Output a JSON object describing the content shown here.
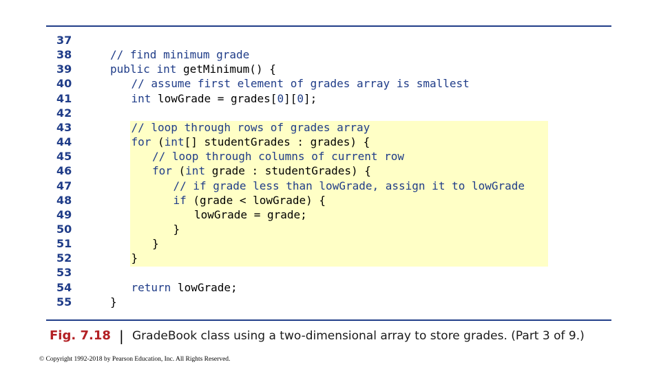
{
  "colors": {
    "rule": "#1f3c88",
    "highlight": "#ffffc6",
    "keyword": "#1f3c88",
    "figure_label": "#b32024"
  },
  "code": [
    {
      "line": "37",
      "indent": 0,
      "tokens": []
    },
    {
      "line": "38",
      "indent": 0,
      "tokens": [
        {
          "t": "// find minimum grade",
          "c": "cm"
        }
      ]
    },
    {
      "line": "39",
      "indent": 0,
      "tokens": [
        {
          "t": "public",
          "c": "kw"
        },
        {
          "t": " "
        },
        {
          "t": "int",
          "c": "kw"
        },
        {
          "t": " getMinimum() {"
        }
      ]
    },
    {
      "line": "40",
      "indent": 1,
      "tokens": [
        {
          "t": "// assume first element of grades array is smallest",
          "c": "cm"
        }
      ]
    },
    {
      "line": "41",
      "indent": 1,
      "tokens": [
        {
          "t": "int",
          "c": "kw"
        },
        {
          "t": " lowGrade = grades["
        },
        {
          "t": "0",
          "c": "num"
        },
        {
          "t": "]["
        },
        {
          "t": "0",
          "c": "num"
        },
        {
          "t": "];"
        }
      ]
    },
    {
      "line": "42",
      "indent": 0,
      "tokens": []
    },
    {
      "line": "43",
      "indent": 1,
      "tokens": [
        {
          "t": "// loop through rows of grades array",
          "c": "cm"
        }
      ]
    },
    {
      "line": "44",
      "indent": 1,
      "tokens": [
        {
          "t": "for",
          "c": "kw"
        },
        {
          "t": " ("
        },
        {
          "t": "int",
          "c": "kw"
        },
        {
          "t": "[] studentGrades : grades) {"
        }
      ]
    },
    {
      "line": "45",
      "indent": 2,
      "tokens": [
        {
          "t": "// loop through columns of current row",
          "c": "cm"
        }
      ]
    },
    {
      "line": "46",
      "indent": 2,
      "tokens": [
        {
          "t": "for",
          "c": "kw"
        },
        {
          "t": " ("
        },
        {
          "t": "int",
          "c": "kw"
        },
        {
          "t": " grade : studentGrades) {"
        }
      ]
    },
    {
      "line": "47",
      "indent": 3,
      "tokens": [
        {
          "t": "// if grade less than lowGrade, assign it to lowGrade",
          "c": "cm"
        }
      ]
    },
    {
      "line": "48",
      "indent": 3,
      "tokens": [
        {
          "t": "if",
          "c": "kw"
        },
        {
          "t": " (grade < lowGrade) {"
        }
      ]
    },
    {
      "line": "49",
      "indent": 4,
      "tokens": [
        {
          "t": "lowGrade = grade;"
        }
      ]
    },
    {
      "line": "50",
      "indent": 3,
      "tokens": [
        {
          "t": "}"
        }
      ]
    },
    {
      "line": "51",
      "indent": 2,
      "tokens": [
        {
          "t": "}"
        }
      ]
    },
    {
      "line": "52",
      "indent": 1,
      "tokens": [
        {
          "t": "}"
        }
      ]
    },
    {
      "line": "53",
      "indent": 0,
      "tokens": []
    },
    {
      "line": "54",
      "indent": 1,
      "tokens": [
        {
          "t": "return",
          "c": "kw"
        },
        {
          "t": " lowGrade;"
        }
      ]
    },
    {
      "line": "55",
      "indent": 0,
      "tokens": [
        {
          "t": "}"
        }
      ]
    }
  ],
  "caption": {
    "label": "Fig. 7.18",
    "separator": "|",
    "text": "GradeBook class using a two-dimensional array to store grades. (Part 3 of 9.)"
  },
  "copyright": "© Copyright 1992-2018 by Pearson Education, Inc. All Rights Reserved."
}
